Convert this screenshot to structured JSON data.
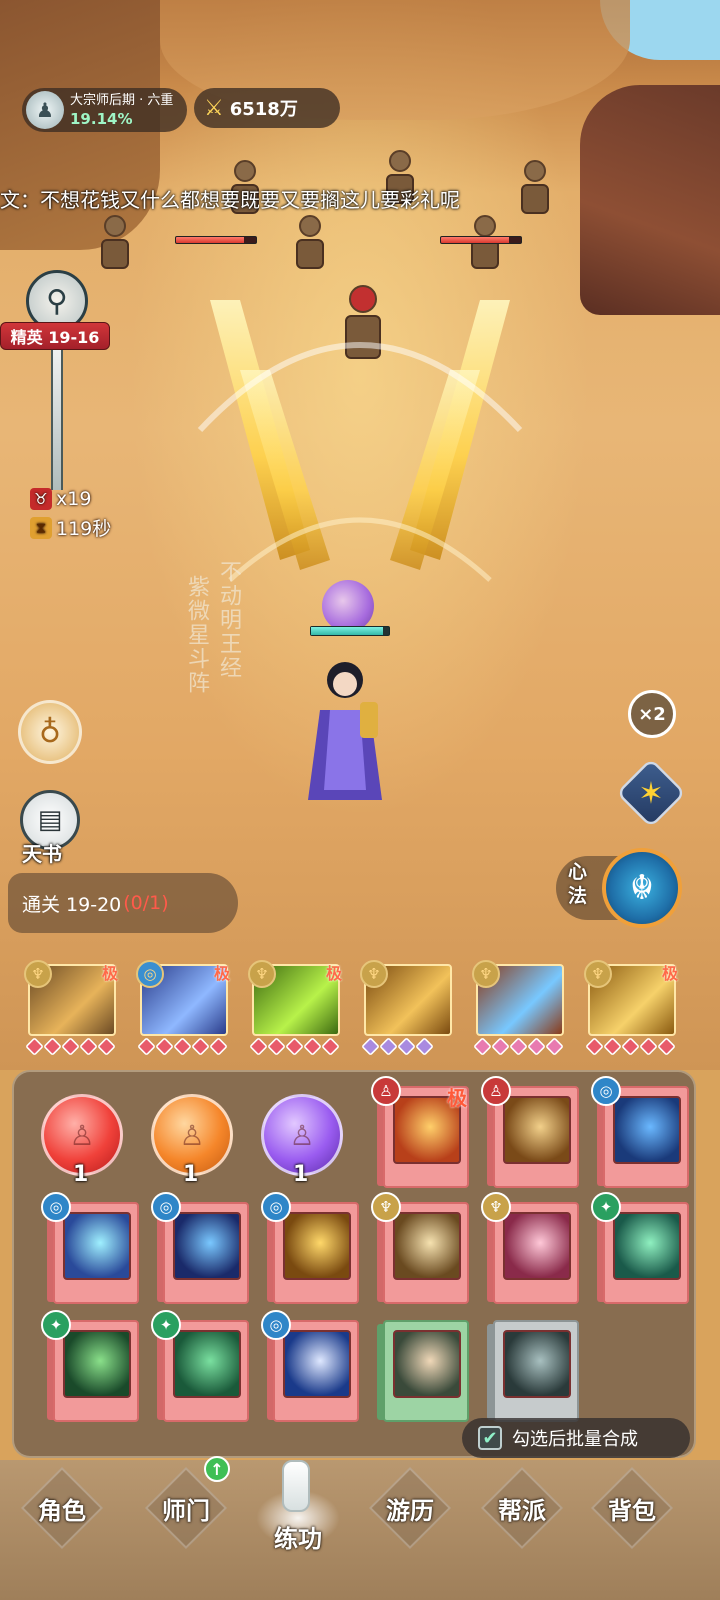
{
  "hud": {
    "realm": "大宗师后期 · 六重",
    "realm_progress": "19.14%",
    "power": "6518万"
  },
  "chat": {
    "message": "文：不想花钱又什么都想要既要又要搁这儿要彩礼呢"
  },
  "stage": {
    "tag": "精英 19-16",
    "enemies_left": "x19",
    "time_left": "119秒"
  },
  "battle_text": {
    "skill_a": "紫微星斗阵",
    "skill_b": "不动明王经"
  },
  "side_buttons": {
    "book_label": "天书",
    "speed_label": "×2",
    "xinfa_label": "心法"
  },
  "clear": {
    "label": "通关 19-20",
    "progress": "(0/1)"
  },
  "equipped": [
    {
      "icon": "sword",
      "badge_color": "#c8a24a",
      "art": "#6b4a24",
      "art2": "#e7b35a",
      "ji": "极",
      "pips": 5,
      "pip_color": "#e85a6a"
    },
    {
      "icon": "wave",
      "badge_color": "#3a8fd0",
      "art": "#2a3c8a",
      "art2": "#8fb8ff",
      "ji": "极",
      "pips": 5,
      "pip_color": "#e85a6a"
    },
    {
      "icon": "sword",
      "badge_color": "#c8a24a",
      "art": "#3d6a10",
      "art2": "#b8f24a",
      "ji": "极",
      "pips": 5,
      "pip_color": "#e85a6a"
    },
    {
      "icon": "sword",
      "badge_color": "#c8a24a",
      "art": "#7a4a10",
      "art2": "#f2c25a",
      "ji": "",
      "pips": 4,
      "pip_color": "#a98ae0"
    },
    {
      "icon": "sword",
      "badge_color": "#c8a24a",
      "art": "#8a3a18",
      "art2": "#78c8ff",
      "ji": "",
      "pips": 5,
      "pip_color": "#e87ab0"
    },
    {
      "icon": "sword",
      "badge_color": "#c8a24a",
      "art": "#8a5a10",
      "art2": "#f6d16a",
      "ji": "极",
      "pips": 5,
      "pip_color": "#e85a6a"
    }
  ],
  "inventory": {
    "orbs": [
      {
        "color": "red",
        "count": "1"
      },
      {
        "color": "orange",
        "count": "1"
      },
      {
        "color": "purple",
        "count": "1"
      }
    ],
    "books": [
      {
        "type": "meditate",
        "ji": "极",
        "art": "#b8401a",
        "art2": "#ffcf6a",
        "cover": "red"
      },
      {
        "type": "meditate",
        "ji": "",
        "art": "#7a4a18",
        "art2": "#f2d08a",
        "cover": "red"
      },
      {
        "type": "wave",
        "ji": "",
        "art": "#1a3a7a",
        "art2": "#6ab8ff",
        "cover": "red"
      },
      {
        "type": "wave",
        "ji": "",
        "art": "#2a4a9a",
        "art2": "#9ff0ff",
        "cover": "red"
      },
      {
        "type": "wave",
        "ji": "",
        "art": "#1a2a6a",
        "art2": "#7ac8ff",
        "cover": "red"
      },
      {
        "type": "wave",
        "ji": "",
        "art": "#7a4a10",
        "art2": "#ffd86a",
        "cover": "red"
      },
      {
        "type": "sword",
        "ji": "",
        "art": "#6a4a20",
        "art2": "#f6e2b0",
        "cover": "red"
      },
      {
        "type": "sword",
        "ji": "",
        "art": "#8a2a4a",
        "art2": "#ffc8d8",
        "cover": "red"
      },
      {
        "type": "leaf",
        "ji": "",
        "art": "#1a5a4a",
        "art2": "#8ff0c0",
        "cover": "red"
      },
      {
        "type": "leaf",
        "ji": "",
        "art": "#1a4a2a",
        "art2": "#8ae08a",
        "cover": "red"
      },
      {
        "type": "leaf",
        "ji": "",
        "art": "#1a5a3a",
        "art2": "#7ae0a0",
        "cover": "red"
      },
      {
        "type": "wave",
        "ji": "",
        "art": "#1a3a8a",
        "art2": "#dfe8ff",
        "cover": "red"
      },
      {
        "type": "none",
        "ji": "",
        "art": "#3a4a3a",
        "art2": "#f0d8b8",
        "cover": "green"
      },
      {
        "type": "none",
        "ji": "",
        "art": "#2a3a3a",
        "art2": "#a8c0c0",
        "cover": "grey"
      }
    ],
    "merge_label": "勾选后批量合成"
  },
  "nav": [
    {
      "label": "角色"
    },
    {
      "label": "师门"
    },
    {
      "label": "练功"
    },
    {
      "label": "游历"
    },
    {
      "label": "帮派"
    },
    {
      "label": "背包"
    }
  ],
  "icons": {
    "sword": "♆",
    "wave": "◎",
    "meditate": "♙",
    "leaf": "✦"
  }
}
